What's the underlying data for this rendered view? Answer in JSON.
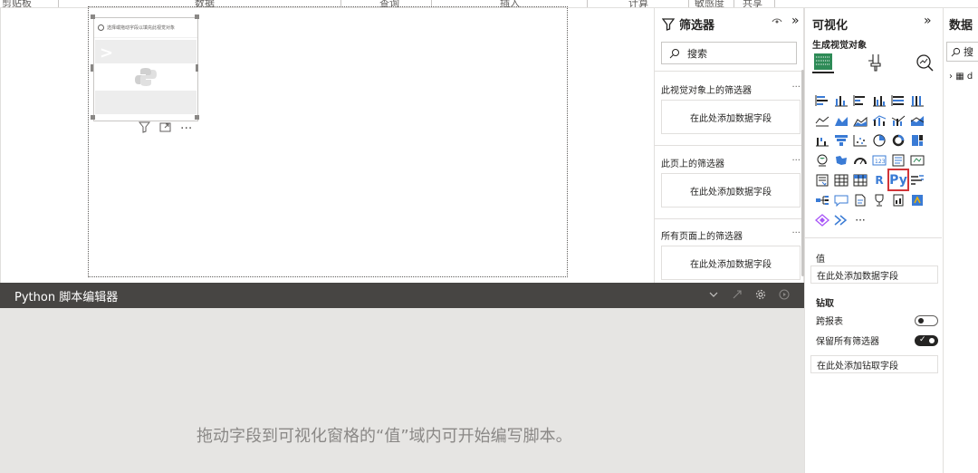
{
  "ribbon": {
    "groups": [
      "剪贴板",
      "数据",
      "查询",
      "插入",
      "计算",
      "敏感度",
      "共享"
    ]
  },
  "visual": {
    "hint": "选择或拖动字段以填充此视觉对象"
  },
  "filters": {
    "title": "筛选器",
    "search_placeholder": "搜索",
    "sections": [
      {
        "label": "此视觉对象上的筛选器",
        "drop": "在此处添加数据字段"
      },
      {
        "label": "此页上的筛选器",
        "drop": "在此处添加数据字段"
      },
      {
        "label": "所有页面上的筛选器",
        "drop": "在此处添加数据字段"
      }
    ],
    "more": "···"
  },
  "python_editor": {
    "title": "Python 脚本编辑器",
    "hint": "拖动字段到可视化窗格的“值”域内可开始编写脚本。"
  },
  "visualizations": {
    "title": "可视化",
    "subtitle": "生成视觉对象",
    "more_visuals": "···",
    "values_label": "值",
    "values_drop": "在此处添加数据字段",
    "drillthrough_title": "钻取",
    "cross_report_label": "跨报表",
    "cross_report_on": false,
    "keep_filters_label": "保留所有筛选器",
    "keep_filters_on": true,
    "drill_drop": "在此处添加钻取字段",
    "selected_visual": "Py"
  },
  "data_pane": {
    "title": "数据",
    "search_placeholder": "搜",
    "tree_item": "d"
  },
  "colors": {
    "editor_bar": "#474543",
    "editor_body": "#e6e5e3",
    "selection_outline": "#d13438",
    "accent_blue": "#3a7bd5",
    "chart_green": "#2e8b57"
  }
}
